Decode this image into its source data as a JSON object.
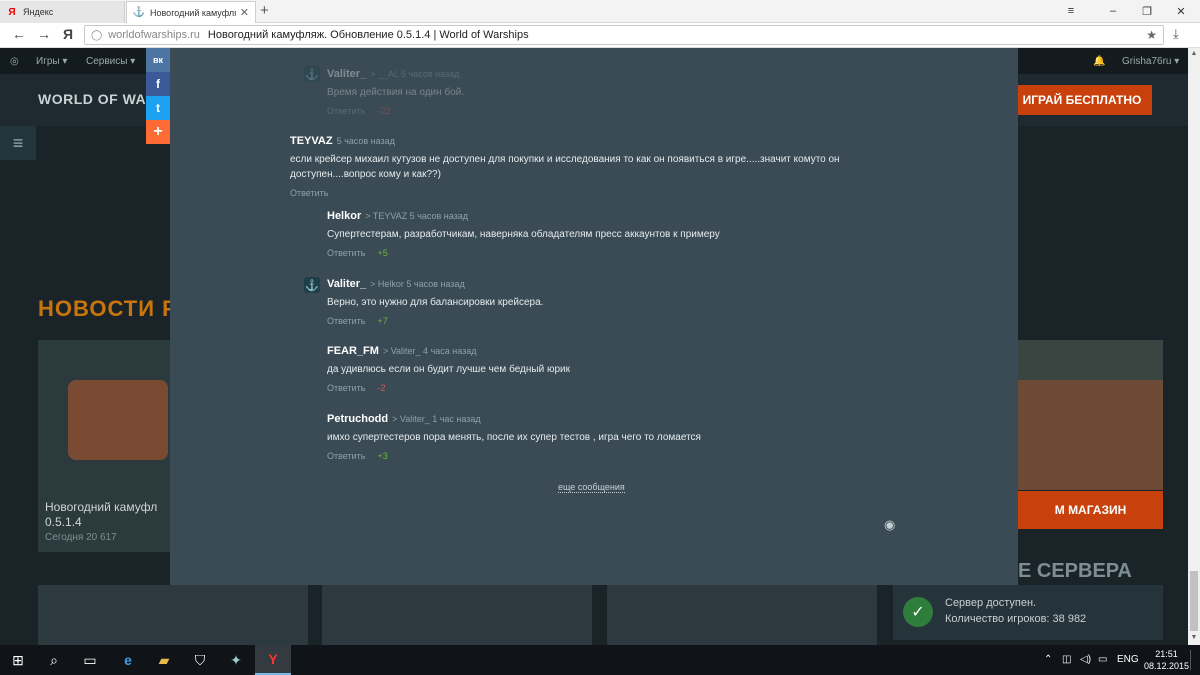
{
  "browser": {
    "tabs": [
      {
        "icon": "Я",
        "label": "Яндекс"
      },
      {
        "icon": "⚓",
        "label": "Новогодний камуфляж",
        "close": "✕"
      }
    ],
    "new_tab": "+",
    "window_controls": {
      "menu": "≡",
      "minimize": "–",
      "restore": "❐",
      "close": "✕"
    },
    "nav": {
      "back": "←",
      "forward": "→",
      "yandex": "Я"
    },
    "address": {
      "domain": "worldofwarships.ru",
      "page_title": "Новогодний камуфляж. Обновление 0.5.1.4 | World of Warships",
      "star": "★"
    },
    "download": "⤓"
  },
  "site": {
    "topnav": {
      "games": "Игры ▾",
      "services": "Сервисы ▾",
      "user": "Grisha76ru ▾"
    },
    "logo": "WORLD OF WARSHIPS",
    "play_button": "ИГРАЙ БЕСПЛАТНО",
    "news_heading": "НОВОСТИ РА",
    "left_card": {
      "title_line1": "Новогодний камуфл",
      "title_line2": "0.5.1.4",
      "meta": "Сегодня  20 617"
    },
    "shop_button": "М МАГАЗИН",
    "server_heading": "Е СЕРВЕРА",
    "server": {
      "status": "Сервер доступен.",
      "players": "Количество игроков: 38 982",
      "icon": "✓"
    }
  },
  "social": {
    "vk": "вк",
    "facebook": "f",
    "twitter": "t",
    "more": "+"
  },
  "comments": {
    "items": [
      {
        "author": "Valiter_",
        "reply_to": "> __AL  5 часов назад",
        "text": "Время действия на один бой.",
        "reply": "Ответить",
        "rating": "-22"
      },
      {
        "author": "TEYVAZ",
        "reply_to": "5 часов назад",
        "text": "если крейсер михаил кутузов не доступен для покупки и исследования то как он появиться в игре.....значит комуто он доступен....вопрос кому и как??)",
        "reply": "Ответить",
        "rating": ""
      },
      {
        "author": "Helkor",
        "reply_to": "> TEYVAZ  5 часов назад",
        "text": "Супертестерам, разработчикам, наверняка обладателям пресс аккаунтов к примеру",
        "reply": "Ответить",
        "rating": "+5"
      },
      {
        "author": "Valiter_",
        "reply_to": "> Helkor  5 часов назад",
        "text": "Верно, это нужно для балансировки крейсера.",
        "reply": "Ответить",
        "rating": "+7"
      },
      {
        "author": "FEAR_FM",
        "reply_to": "> Valiter_  4 часа назад",
        "text": "да удивлюсь если он будит лучше чем бедный юрик",
        "reply": "Ответить",
        "rating": "-2"
      },
      {
        "author": "Petruchodd",
        "reply_to": "> Valiter_  1 час назад",
        "text": "имхо супертестеров пора менять, после их супер тестов , игра чего то ломается",
        "reply": "Ответить",
        "rating": "+3"
      }
    ],
    "more_label": "еще сообщения",
    "rss_icon": "◉"
  },
  "taskbar": {
    "lang": "ENG",
    "time": "21:51",
    "date": "08.12.2015"
  }
}
